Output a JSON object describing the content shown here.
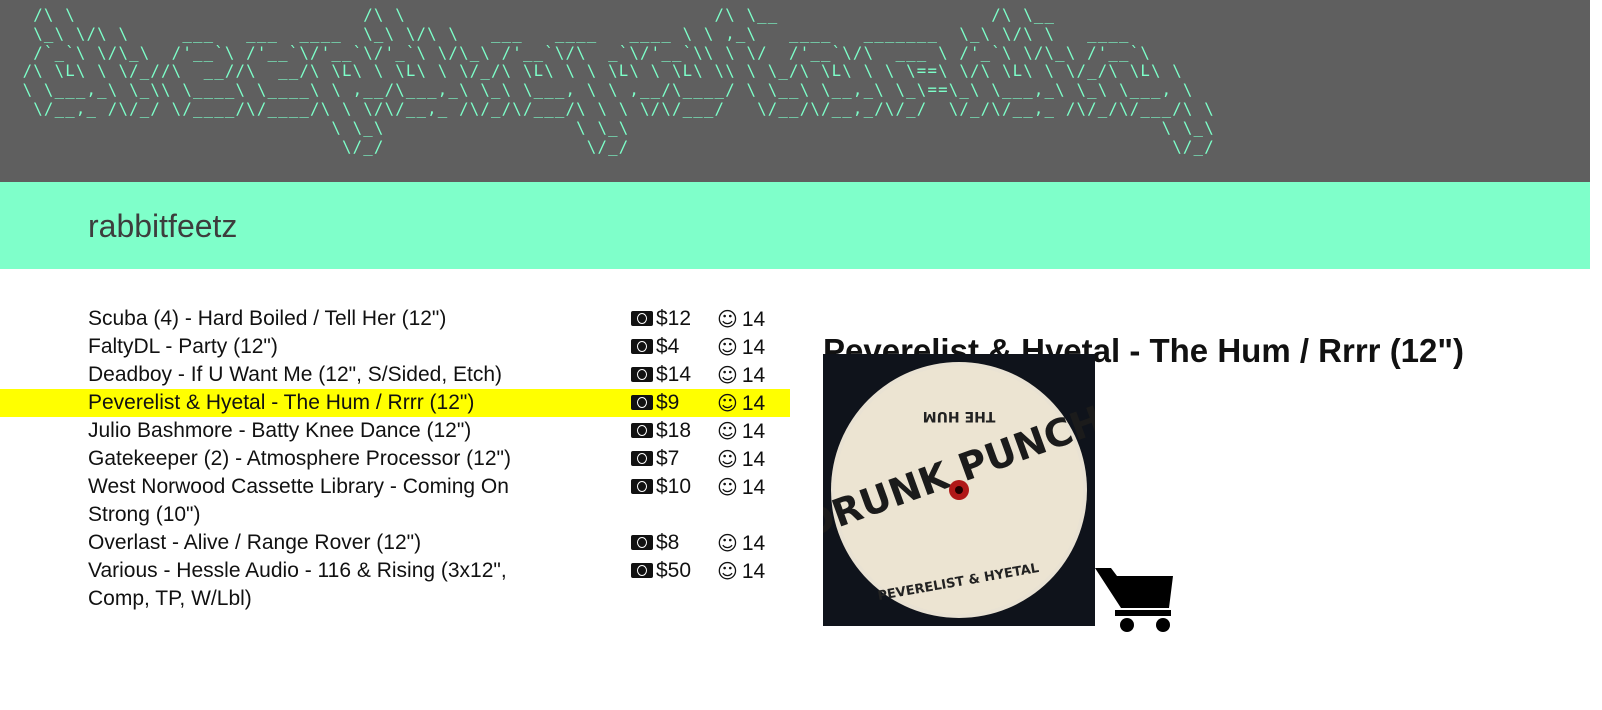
{
  "banner": {
    "ascii_art": "  /\\ \\                            \n  \\_\\ \\/\\ \\     ___   ___  _____  \n  /`_`\\ \\/\\_\\  /'__`\\ /'__`\\/'__`\\\n /\\ \\L\\ \\ \\/_/ /\\  __//\\  __//\\ \\L\\\n \\ \\___,_\\ \\_\\ \\ \\____\\ \\____\\ \\ ,__\n  \\/__,_ /\\/_/  \\/____/\\/____/\\ \\ \\/\n                               \\ \\_\\ \n                                \\/_/ ",
    "alt": "the sep solo sity"
  },
  "user": {
    "name": "rabbitfeetz"
  },
  "records": [
    {
      "title": "Scuba (4) - Hard Boiled / Tell Her (12\")",
      "price": "$12",
      "count": "14"
    },
    {
      "title": "FaltyDL - Party (12\")",
      "price": "$4",
      "count": "14"
    },
    {
      "title": "Deadboy - If U Want Me (12\", S/Sided, Etch)",
      "price": "$14",
      "count": "14"
    },
    {
      "title": "Peverelist & Hyetal - The Hum / Rrrr (12\")",
      "price": "$9",
      "count": "14"
    },
    {
      "title": "Julio Bashmore - Batty Knee Dance (12\")",
      "price": "$18",
      "count": "14"
    },
    {
      "title": "Gatekeeper (2) - Atmosphere Processor (12\")",
      "price": "$7",
      "count": "14"
    },
    {
      "title": "West Norwood Cassette Library - Coming On Strong (10\")",
      "price": "$10",
      "count": "14"
    },
    {
      "title": "Overlast - Alive / Range Rover (12\")",
      "price": "$8",
      "count": "14"
    },
    {
      "title": "Various - Hessle Audio - 116 & Rising (3x12\", Comp, TP, W/Lbl)",
      "price": "$50",
      "count": "14"
    }
  ],
  "selected_index": 3,
  "detail": {
    "title": "Peverelist & Hyetal - The Hum / Rrrr (12\")",
    "label_top": "THE HUM",
    "label_center": "DRUNK PUNCH",
    "label_bottom": "PEVERELIST & HYETAL"
  },
  "icons": {
    "price": "money-icon",
    "count": "smiley-icon",
    "cart": "cart-icon"
  },
  "colors": {
    "banner_bg": "#5f5f5f",
    "banner_text": "#7dffc9",
    "userbar_bg": "#7fffca",
    "selected_row": "#ffff00"
  }
}
